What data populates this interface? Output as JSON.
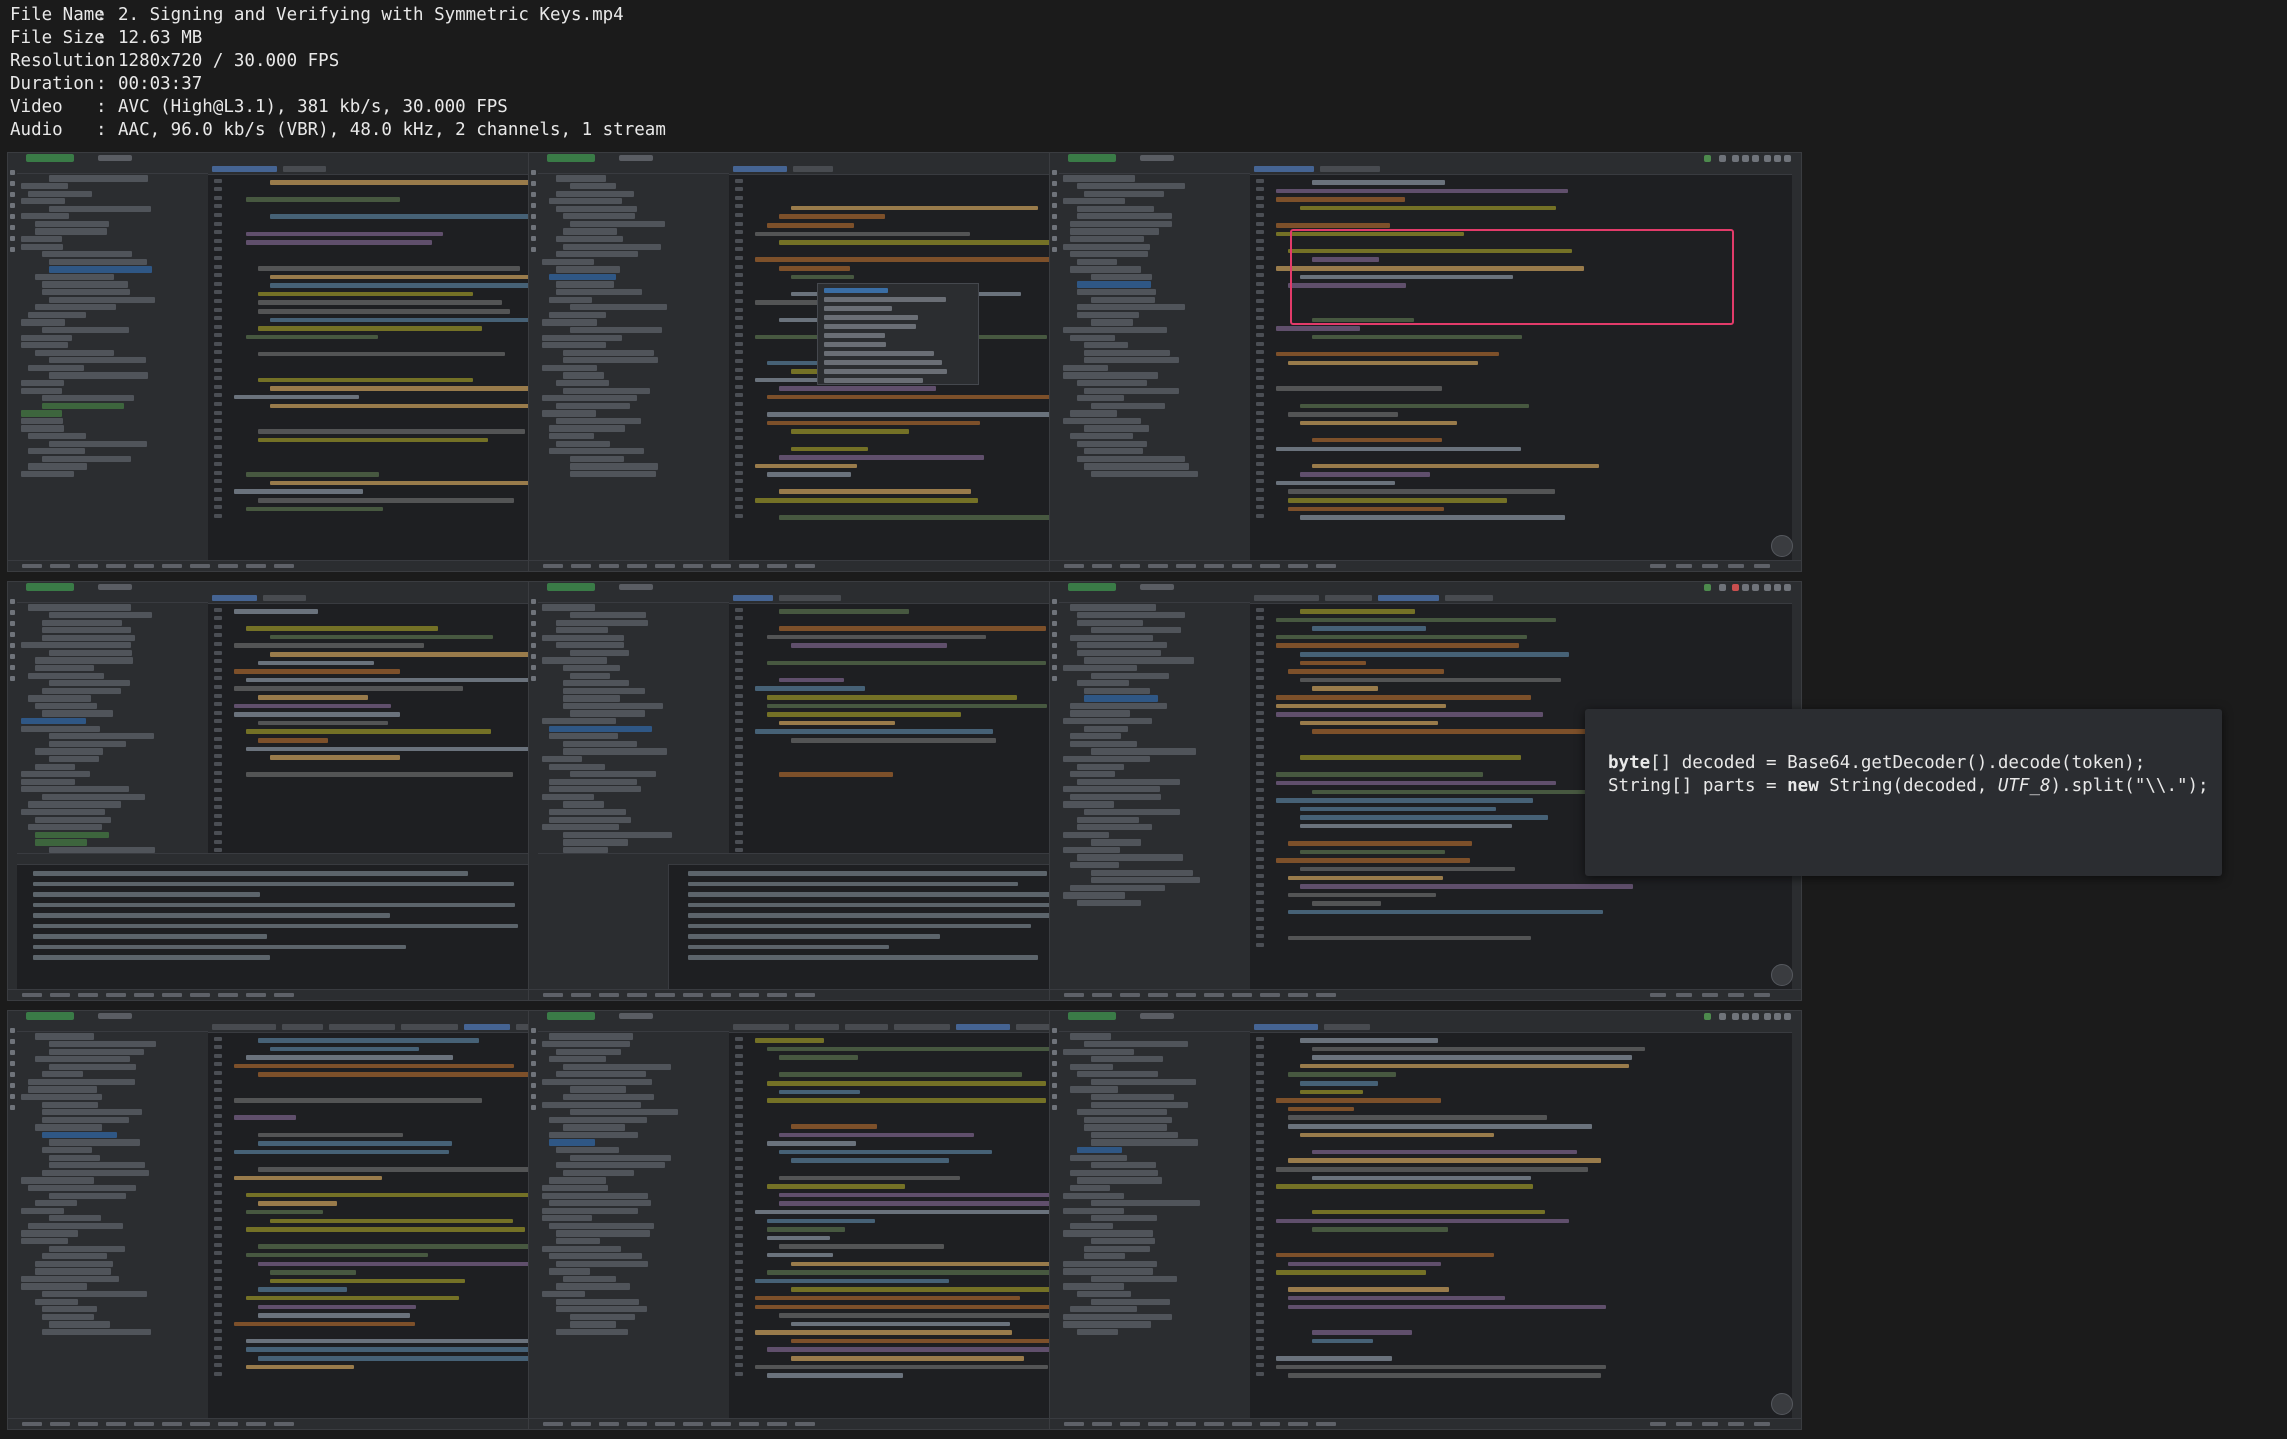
{
  "meta": {
    "rows": [
      {
        "key": "File Name",
        "sep": ":",
        "value": "2. Signing and Verifying with Symmetric Keys.mp4"
      },
      {
        "key": "File Size",
        "sep": ":",
        "value": "12.63 MB"
      },
      {
        "key": "Resolution",
        "sep": ":",
        "value": "1280x720 / 30.000 FPS"
      },
      {
        "key": "Duration",
        "sep": ":",
        "value": "00:03:37"
      },
      {
        "key": "Video",
        "sep": ":",
        "value": "AVC (High@L3.1), 381 kb/s, 30.000 FPS"
      },
      {
        "key": "Audio",
        "sep": ":",
        "value": "AAC, 96.0 kb/s (VBR), 48.0 kHz, 2 channels, 1 stream"
      }
    ]
  },
  "thumbnails": [
    {
      "variant": "security-config"
    },
    {
      "variant": "security-config-autocomplete"
    },
    {
      "variant": "gateway-test-highlight"
    },
    {
      "variant": "gateway-test-run"
    },
    {
      "variant": "gateway-test-run-failed"
    },
    {
      "variant": "jwtparser-overlay"
    },
    {
      "variant": "hmac-class"
    },
    {
      "variant": "constant-time-utils"
    },
    {
      "variant": "gateway-test-final"
    }
  ],
  "overlay": {
    "line1": {
      "kw1": "byte",
      "t1": "[] decoded = Base64.getDecoder().decode(token);"
    },
    "line2": {
      "t1": "String[] parts = ",
      "kw1": "new",
      "t2": " String(decoded, ",
      "it1": "UTF_8",
      "t3": ").split(\"\\\\.\");"
    }
  },
  "colors": {
    "background": "#1b1b1b",
    "ide_bg": "#1e1f22",
    "ide_panel": "#2b2d30",
    "highlight": "#e23b6a",
    "overlay_bg": "#2b2d31"
  }
}
